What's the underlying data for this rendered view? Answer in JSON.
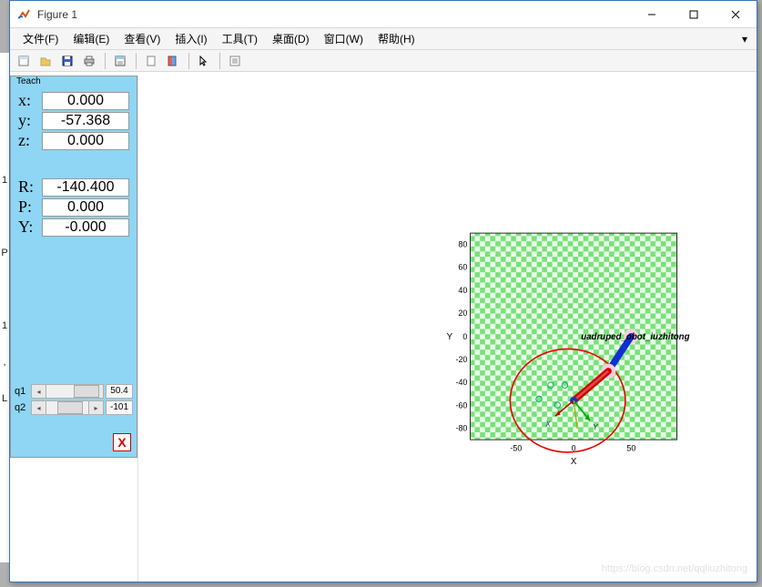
{
  "window": {
    "title": "Figure 1"
  },
  "menu": {
    "file": "文件(F)",
    "edit": "编辑(E)",
    "view": "查看(V)",
    "insert": "插入(I)",
    "tools": "工具(T)",
    "desktop": "桌面(D)",
    "windowm": "窗口(W)",
    "help": "帮助(H)"
  },
  "teach": {
    "title": "Teach",
    "labels": {
      "x": "x:",
      "y": "y:",
      "z": "z:",
      "R": "R:",
      "P": "P:",
      "Y": "Y:"
    },
    "vals": {
      "x": "0.000",
      "y": "-57.368",
      "z": "0.000",
      "R": "-140.400",
      "P": "0.000",
      "Y": "-0.000"
    },
    "sliders": {
      "q1_lab": "q1",
      "q1_val": "50.4",
      "q2_lab": "q2",
      "q2_val": "-101"
    },
    "close": "X"
  },
  "chart_data": {
    "type": "scatter",
    "title": "",
    "xlabel": "X",
    "ylabel": "Y",
    "xlim": [
      -90,
      90
    ],
    "ylim": [
      -90,
      90
    ],
    "x_ticks": [
      -50,
      0,
      50
    ],
    "y_ticks": [
      -80,
      -60,
      -40,
      -20,
      0,
      20,
      40,
      60,
      80
    ],
    "annotation": "uadruped_obot_iuzhitong",
    "annotation_xy": [
      5,
      0
    ],
    "robot": {
      "base": [
        50,
        0
      ],
      "joint": [
        30,
        -30
      ],
      "end_effector": [
        0,
        -56
      ],
      "frame_labels": {
        "x": "X",
        "y": "Y"
      }
    },
    "red_circle": {
      "cx": -5,
      "cy": -56,
      "r": 50
    },
    "trajectory_points": [
      {
        "x": -30,
        "y": -55
      },
      {
        "x": -20,
        "y": -42
      },
      {
        "x": -8,
        "y": -42
      },
      {
        "x": -14,
        "y": -60
      },
      {
        "x": 0,
        "y": -56
      }
    ]
  },
  "watermark": "https://blog.csdn.net/qqliuzhitong"
}
